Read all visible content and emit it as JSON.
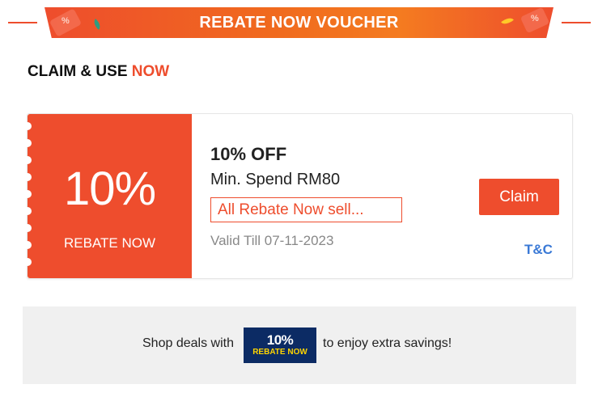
{
  "header": {
    "title": "REBATE NOW VOUCHER",
    "accent_color": "#ee4d2d"
  },
  "section": {
    "heading_prefix": "CLAIM & USE",
    "heading_accent": "NOW"
  },
  "voucher": {
    "big_value": "10%",
    "big_label": "REBATE NOW",
    "title": "10% OFF",
    "min_spend": "Min. Spend RM80",
    "seller_tag": "All Rebate Now sell...",
    "validity": "Valid Till 07-11-2023",
    "claim_label": "Claim",
    "tc_label": "T&C"
  },
  "info": {
    "text_before": "Shop deals with",
    "badge_value": "10%",
    "badge_label": "REBATE NOW",
    "text_after": "to enjoy extra savings!",
    "badge_color": "#0c2b64",
    "badge_label_color": "#ffd400"
  },
  "icons": [
    "coupon-icon",
    "leaf-icon"
  ]
}
